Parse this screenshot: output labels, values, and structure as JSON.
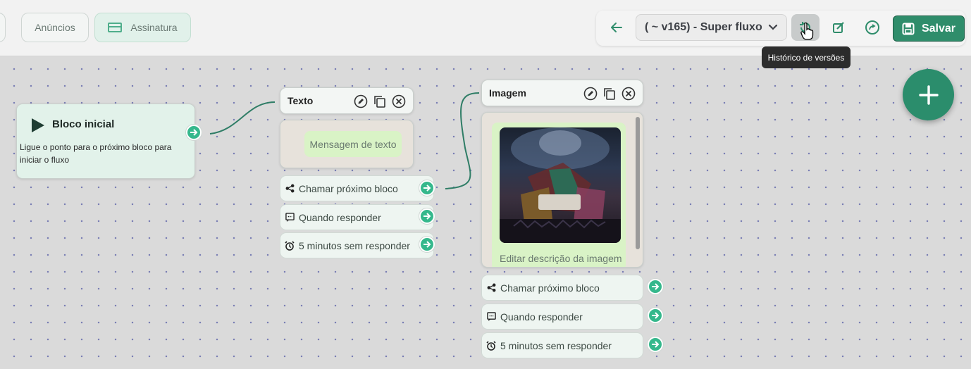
{
  "topbar": {
    "tabs": [
      {
        "label": "Anúncios"
      },
      {
        "label": "Assinatura"
      }
    ],
    "version_select": "( ~ v165) - Super fluxo",
    "save_label": "Salvar",
    "tooltip": "Histórico de versões"
  },
  "colors": {
    "accent": "#2f8d6b",
    "connector": "#35b88c",
    "canvas_bg": "#dadada"
  },
  "start_block": {
    "title": "Bloco inicial",
    "description": "Ligue o ponto para o próximo bloco para iniciar o fluxo"
  },
  "text_block": {
    "title": "Texto",
    "message": "Mensagem de texto",
    "options": [
      {
        "icon": "share-icon",
        "label": "Chamar próximo bloco"
      },
      {
        "icon": "comment-icon",
        "label": "Quando responder"
      },
      {
        "icon": "alarm-icon",
        "label": "5 minutos sem responder"
      }
    ]
  },
  "image_block": {
    "title": "Imagem",
    "image_caption": "Editar descrição da imagem",
    "options": [
      {
        "icon": "share-icon",
        "label": "Chamar próximo bloco"
      },
      {
        "icon": "comment-icon",
        "label": "Quando responder"
      },
      {
        "icon": "alarm-icon",
        "label": "5 minutos sem responder"
      }
    ]
  }
}
